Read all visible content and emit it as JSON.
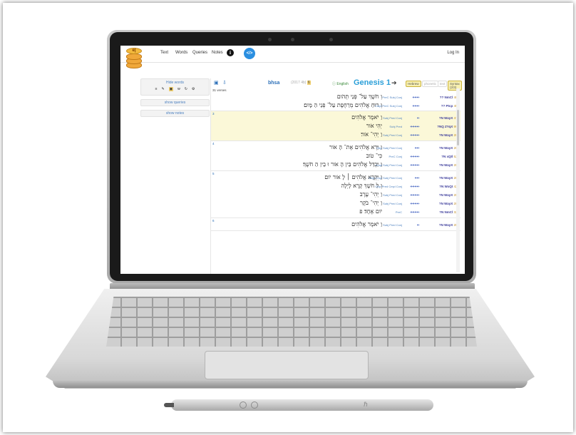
{
  "header": {
    "logo_text": "e|",
    "nav": [
      "Text",
      "Words",
      "Queries",
      "Notes"
    ],
    "login": "Log In"
  },
  "sidebar": {
    "hide_words": "Hide words",
    "word_icons": [
      "≡",
      "✎",
      "◉",
      "w",
      "↻",
      "⚙"
    ],
    "show_queries": "show queries",
    "show_notes": "show notes"
  },
  "toolbar": {
    "corpus": "bhsa",
    "version_left": "2017",
    "version_right": "4b",
    "version_count": "6",
    "language": "English",
    "book": "Genesis",
    "chapter": "1",
    "buttons": [
      "Hebrew",
      "phonetic",
      "text",
      "Syntax (2/3)"
    ],
    "verse_count": "31 verses"
  },
  "verses": [
    {
      "num": "",
      "lines": [
        {
          "heb": "וְ חֹשֶׁךְ עַל־ פְּנֵי תְהֹום",
          "funcs": "PreC  Subj  Conj",
          "arr": "↞↞↞",
          "clause": "?? NmCl",
          "code": "402"
        },
        {
          "heb": "וְ רוּחַ אֱלֹהִים מְרַחֶפֶת עַל־ פְּנֵי הַ מָּיִם׃",
          "funcs": "Cmpl  PreC  Subj  Conj",
          "arr": "↞↞↞",
          "clause": "?? Ptcp",
          "code": "450"
        }
      ]
    },
    {
      "num": "3",
      "highlight": true,
      "lines": [
        {
          "heb": "וַ יֹּאמֶר אֱלֹהִים",
          "funcs": "Subj  Pred  Conj",
          "arr": "↞",
          "clause": "?N WayX",
          "code": "470"
        },
        {
          "heb": "יְהִי אֹור",
          "funcs": "Subj  Pred",
          "arr": "↞↞↞↞",
          "clause": "?NQ ZYqX",
          "code": "999"
        },
        {
          "heb": "וַ יְהִי־ אֹור׃",
          "funcs": "Subj  Pred  Conj",
          "arr": "↞↞↞↞",
          "clause": "?N WayX",
          "code": "200"
        }
      ]
    },
    {
      "num": "4",
      "lines": [
        {
          "heb": "וַ יַּרְא אֱלֹהִים אֶת־ הָ אֹור",
          "funcs": "Objc  Subj  Pred  Conj",
          "arr": "↞↞",
          "clause": "?N WayX",
          "code": "205"
        },
        {
          "heb": "כִּי־ טֹוב",
          "funcs": "PreC  Conj",
          "arr": "↞↞↞↞",
          "clause": "?N xQtl",
          "code": "527"
        },
        {
          "heb": "וַ יַּבְדֵּל אֱלֹהִים בֵּין הָ אֹור וּ בֵין הַ חֹשֶׁךְ׃",
          "funcs": "Cmpl  Subj  Pred  Conj",
          "arr": "↞↞↞↞",
          "clause": "?N WayX",
          "code": "200"
        }
      ]
    },
    {
      "num": "5",
      "lines": [
        {
          "heb": "וַ יִּקְרָא אֱלֹהִים ׀ לָ אֹור יֹום",
          "funcs": "Objc  Cmpl  Subj  Pred  Conj",
          "arr": "↞↞",
          "clause": "?N WayX",
          "code": "200"
        },
        {
          "heb": "וְ לַ חֹשֶׁךְ קָרָא לָיְלָה",
          "funcs": "Objc  Pred  Cmpl  Conj",
          "arr": "↞↞↞↞",
          "clause": "?N WxQt",
          "code": "427"
        },
        {
          "heb": "וַ יְהִי־ עֶרֶב",
          "funcs": "Subj  Pred  Conj",
          "arr": "↞↞↞↞",
          "clause": "?N WayX",
          "code": "200"
        },
        {
          "heb": "וַ יְהִי־ בֹקֶר",
          "funcs": "Subj  Pred  Conj",
          "arr": "↞↞↞↞",
          "clause": "?N WayX",
          "code": "200"
        },
        {
          "heb": "יֹום אֶחָד׃ פ",
          "funcs": "PreC",
          "arr": "↞↞↞↞",
          "clause": "?N NmCl",
          "code": "327"
        }
      ]
    },
    {
      "num": "6",
      "lines": [
        {
          "heb": "וַ יֹּאמֶר אֱלֹהִים",
          "funcs": "Subj  Pred  Conj",
          "arr": "↞",
          "clause": "?N WayX",
          "code": "200"
        }
      ]
    }
  ],
  "colors": {
    "accent": "#2b9fd8",
    "highlight": "#fbf8d8",
    "logo": "#f3b93c"
  }
}
